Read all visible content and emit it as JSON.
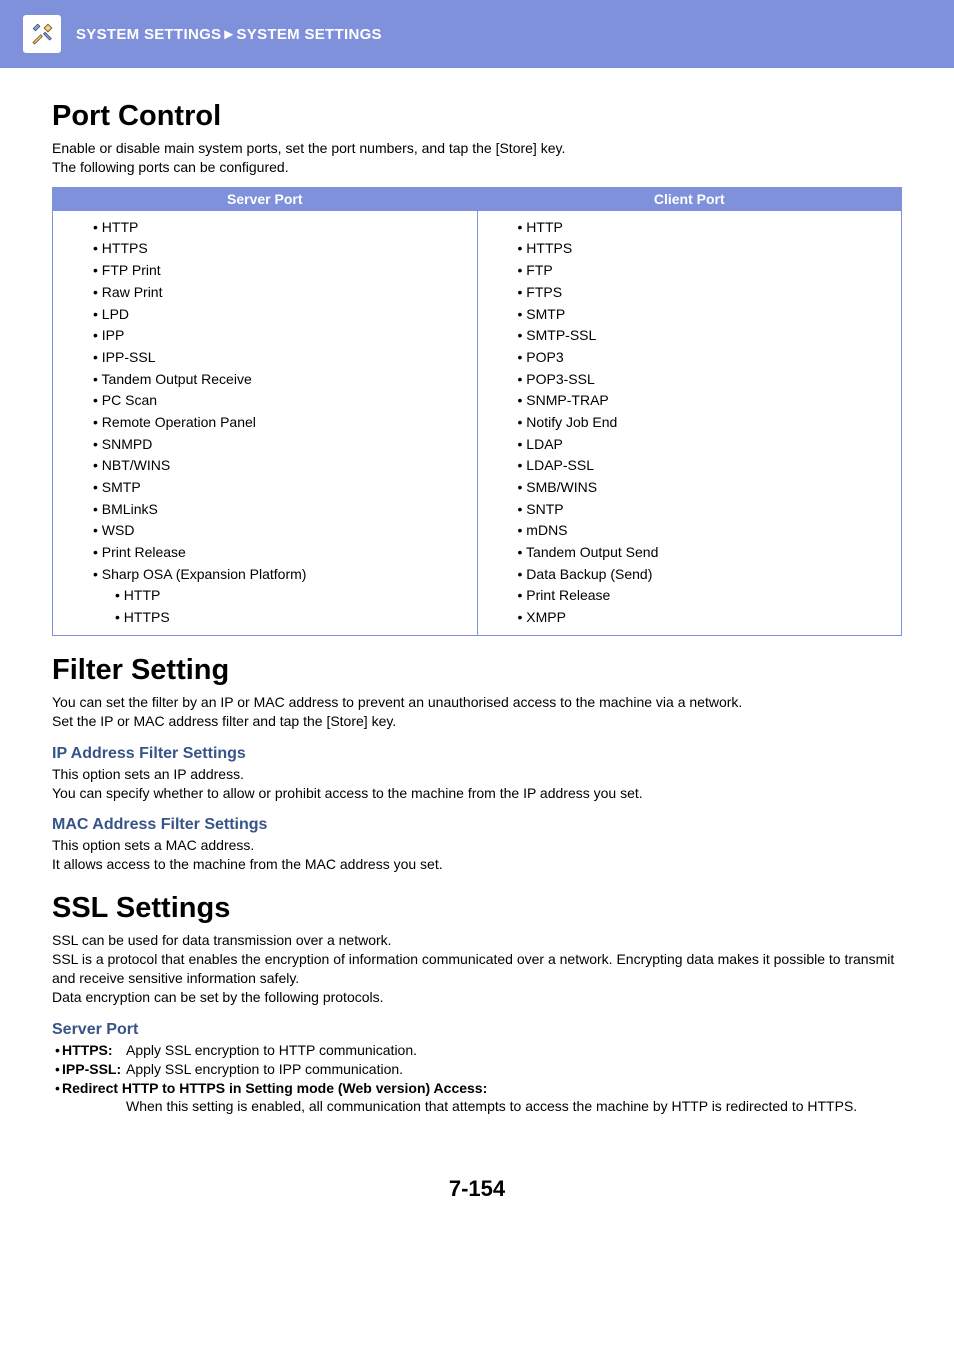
{
  "breadcrumb": "SYSTEM SETTINGS►SYSTEM SETTINGS",
  "port_control": {
    "title": "Port Control",
    "intro_l1": "Enable or disable main system ports, set the port numbers, and tap the [Store] key.",
    "intro_l2": "The following ports can be configured.",
    "server_header": "Server Port",
    "client_header": "Client Port",
    "server_ports": [
      "HTTP",
      "HTTPS",
      "FTP Print",
      "Raw Print",
      "LPD",
      "IPP",
      "IPP-SSL",
      "Tandem Output Receive",
      "PC Scan",
      "Remote Operation Panel",
      "SNMPD",
      "NBT/WINS",
      "SMTP",
      "BMLinkS",
      "WSD",
      "Print Release",
      "Sharp OSA (Expansion Platform)"
    ],
    "server_sub": [
      "HTTP",
      "HTTPS"
    ],
    "client_ports": [
      "HTTP",
      "HTTPS",
      "FTP",
      "FTPS",
      "SMTP",
      "SMTP-SSL",
      "POP3",
      "POP3-SSL",
      "SNMP-TRAP",
      "Notify Job End",
      "LDAP",
      "LDAP-SSL",
      "SMB/WINS",
      "SNTP",
      "mDNS",
      "Tandem Output Send",
      "Data Backup (Send)",
      "Print Release",
      "XMPP"
    ]
  },
  "filter": {
    "title": "Filter Setting",
    "intro_l1": "You can set the filter by an IP or MAC address to prevent an unauthorised access to the machine via a network.",
    "intro_l2": "Set the IP or MAC address filter and tap the [Store] key.",
    "ip_heading": "IP Address Filter Settings",
    "ip_l1": "This option sets an IP address.",
    "ip_l2": "You can specify whether to allow or prohibit access to the machine from the IP address you set.",
    "mac_heading": "MAC Address Filter Settings",
    "mac_l1": "This option sets a MAC address.",
    "mac_l2": "It allows access to the machine from the MAC address you set."
  },
  "ssl": {
    "title": "SSL Settings",
    "intro_l1": "SSL can be used for data transmission over a network.",
    "intro_l2": "SSL is a protocol that enables the encryption of information communicated over a network. Encrypting data makes it possible to transmit and receive sensitive information safely.",
    "intro_l3": "Data encryption can be set by the following protocols.",
    "server_heading": "Server Port",
    "https_term": "HTTPS:",
    "https_desc": "Apply SSL encryption to HTTP communication.",
    "ipp_term": "IPP-SSL:",
    "ipp_desc": "Apply SSL encryption to IPP communication.",
    "redirect_term": "Redirect HTTP to HTTPS in Setting mode (Web version) Access:",
    "redirect_desc": "When this setting is enabled, all communication that attempts to access the machine by HTTP is redirected to HTTPS."
  },
  "page_number": "7-154"
}
